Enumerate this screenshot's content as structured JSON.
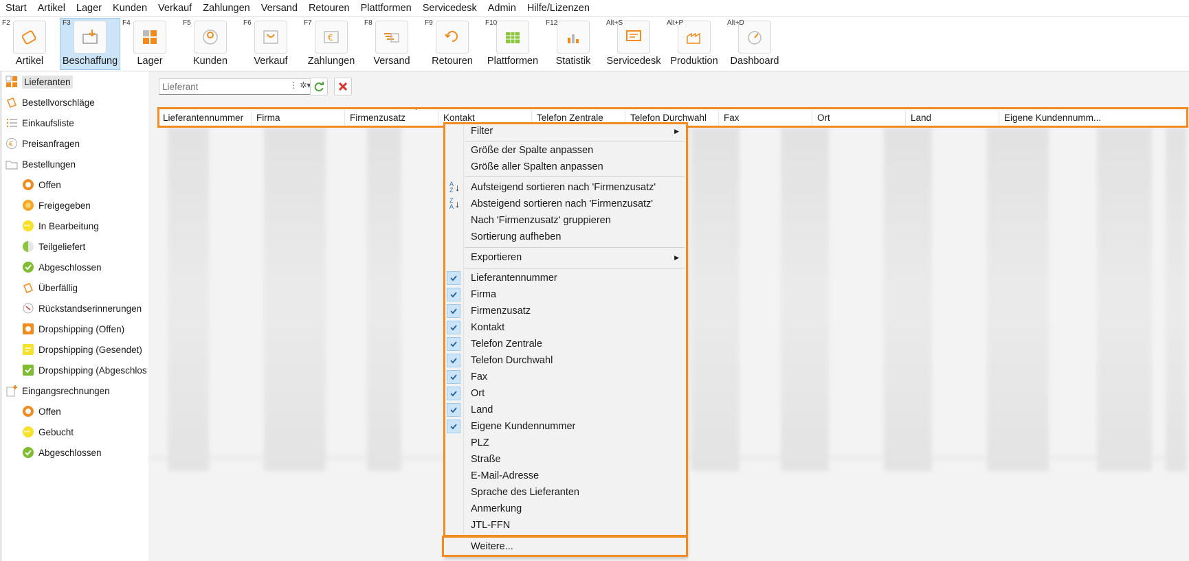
{
  "menubar": [
    "Start",
    "Artikel",
    "Lager",
    "Kunden",
    "Verkauf",
    "Zahlungen",
    "Versand",
    "Retouren",
    "Plattformen",
    "Servicedesk",
    "Admin",
    "Hilfe/Lizenzen"
  ],
  "toolbar": [
    {
      "key": "F2",
      "label": "Artikel",
      "icon": "article-icon"
    },
    {
      "key": "F3",
      "label": "Beschaffung",
      "icon": "procurement-icon",
      "active": true
    },
    {
      "key": "F4",
      "label": "Lager",
      "icon": "warehouse-icon"
    },
    {
      "key": "F5",
      "label": "Kunden",
      "icon": "customers-icon"
    },
    {
      "key": "F6",
      "label": "Verkauf",
      "icon": "sales-icon"
    },
    {
      "key": "F7",
      "label": "Zahlungen",
      "icon": "payments-icon"
    },
    {
      "key": "F8",
      "label": "Versand",
      "icon": "shipping-icon"
    },
    {
      "key": "F9",
      "label": "Retouren",
      "icon": "returns-icon"
    },
    {
      "key": "F10",
      "label": "Plattformen",
      "icon": "platforms-icon"
    },
    {
      "key": "F12",
      "label": "Statistik",
      "icon": "statistics-icon"
    },
    {
      "key": "Alt+S",
      "label": "Servicedesk",
      "icon": "servicedesk-icon"
    },
    {
      "key": "Alt+P",
      "label": "Produktion",
      "icon": "production-icon"
    },
    {
      "key": "Alt+D",
      "label": "Dashboard",
      "icon": "dashboard-icon"
    }
  ],
  "sidebar": [
    {
      "label": "Lieferanten",
      "icon": "suppliers-icon",
      "selected": true
    },
    {
      "label": "Bestellvorschläge",
      "icon": "order-suggestions-icon"
    },
    {
      "label": "Einkaufsliste",
      "icon": "shopping-list-icon"
    },
    {
      "label": "Preisanfragen",
      "icon": "price-inquiry-icon"
    },
    {
      "label": "Bestellungen",
      "icon": "orders-folder-icon"
    },
    {
      "label": "Offen",
      "icon": "status-open-icon",
      "color": "#f28a1e",
      "indent": true
    },
    {
      "label": "Freigegeben",
      "icon": "status-released-icon",
      "color": "#f5a623",
      "indent": true
    },
    {
      "label": "In Bearbeitung",
      "icon": "status-in-progress-icon",
      "color": "#f7e12b",
      "indent": true
    },
    {
      "label": "Teilgeliefert",
      "icon": "status-partial-icon",
      "color": "#8cc63f",
      "indent": true
    },
    {
      "label": "Abgeschlossen",
      "icon": "status-done-icon",
      "color": "#7dbd2f",
      "indent": true
    },
    {
      "label": "Überfällig",
      "icon": "overdue-icon",
      "indent": true
    },
    {
      "label": "Rückstandserinnerungen",
      "icon": "reminder-clock-icon",
      "indent": true
    },
    {
      "label": "Dropshipping (Offen)",
      "icon": "dropship-open-icon",
      "color": "#f28a1e",
      "indent": true
    },
    {
      "label": "Dropshipping (Gesendet)",
      "icon": "dropship-sent-icon",
      "color": "#f7e12b",
      "indent": true
    },
    {
      "label": "Dropshipping (Abgeschlos",
      "icon": "dropship-done-icon",
      "color": "#7dbd2f",
      "indent": true
    },
    {
      "label": "Eingangsrechnungen",
      "icon": "incoming-invoices-icon"
    },
    {
      "label": "Offen",
      "icon": "status-open-icon",
      "color": "#f28a1e",
      "indent": true
    },
    {
      "label": "Gebucht",
      "icon": "status-booked-icon",
      "color": "#f7e12b",
      "indent": true
    },
    {
      "label": "Abgeschlossen",
      "icon": "status-done-icon",
      "color": "#7dbd2f",
      "indent": true
    }
  ],
  "filter": {
    "placeholder": "Lieferant"
  },
  "columns": [
    "Lieferantennummer",
    "Firma",
    "Firmenzusatz",
    "Kontakt",
    "Telefon Zentrale",
    "Telefon Durchwahl",
    "Fax",
    "Ort",
    "Land",
    "Eigene Kundennumm..."
  ],
  "context_menu": {
    "filter": "Filter",
    "fit_column": "Größe der Spalte anpassen",
    "fit_all": "Größe aller Spalten anpassen",
    "sort_asc": "Aufsteigend sortieren nach 'Firmenzusatz'",
    "sort_desc": "Absteigend sortieren nach 'Firmenzusatz'",
    "group": "Nach 'Firmenzusatz' gruppieren",
    "clear_sort": "Sortierung aufheben",
    "export": "Exportieren",
    "column_items": [
      {
        "label": "Lieferantennummer",
        "checked": true
      },
      {
        "label": "Firma",
        "checked": true
      },
      {
        "label": "Firmenzusatz",
        "checked": true
      },
      {
        "label": "Kontakt",
        "checked": true
      },
      {
        "label": "Telefon Zentrale",
        "checked": true
      },
      {
        "label": "Telefon Durchwahl",
        "checked": true
      },
      {
        "label": "Fax",
        "checked": true
      },
      {
        "label": "Ort",
        "checked": true
      },
      {
        "label": "Land",
        "checked": true
      },
      {
        "label": "Eigene Kundennummer",
        "checked": true
      },
      {
        "label": "PLZ",
        "checked": false
      },
      {
        "label": "Straße",
        "checked": false
      },
      {
        "label": "E-Mail-Adresse",
        "checked": false
      },
      {
        "label": "Sprache des Lieferanten",
        "checked": false
      },
      {
        "label": "Anmerkung",
        "checked": false
      },
      {
        "label": "JTL-FFN",
        "checked": false
      }
    ],
    "more": "Weitere..."
  },
  "colors": {
    "highlight": "#f28a1e",
    "check_bg": "#cce4f7",
    "accent_blue": "#2a6ebb"
  }
}
